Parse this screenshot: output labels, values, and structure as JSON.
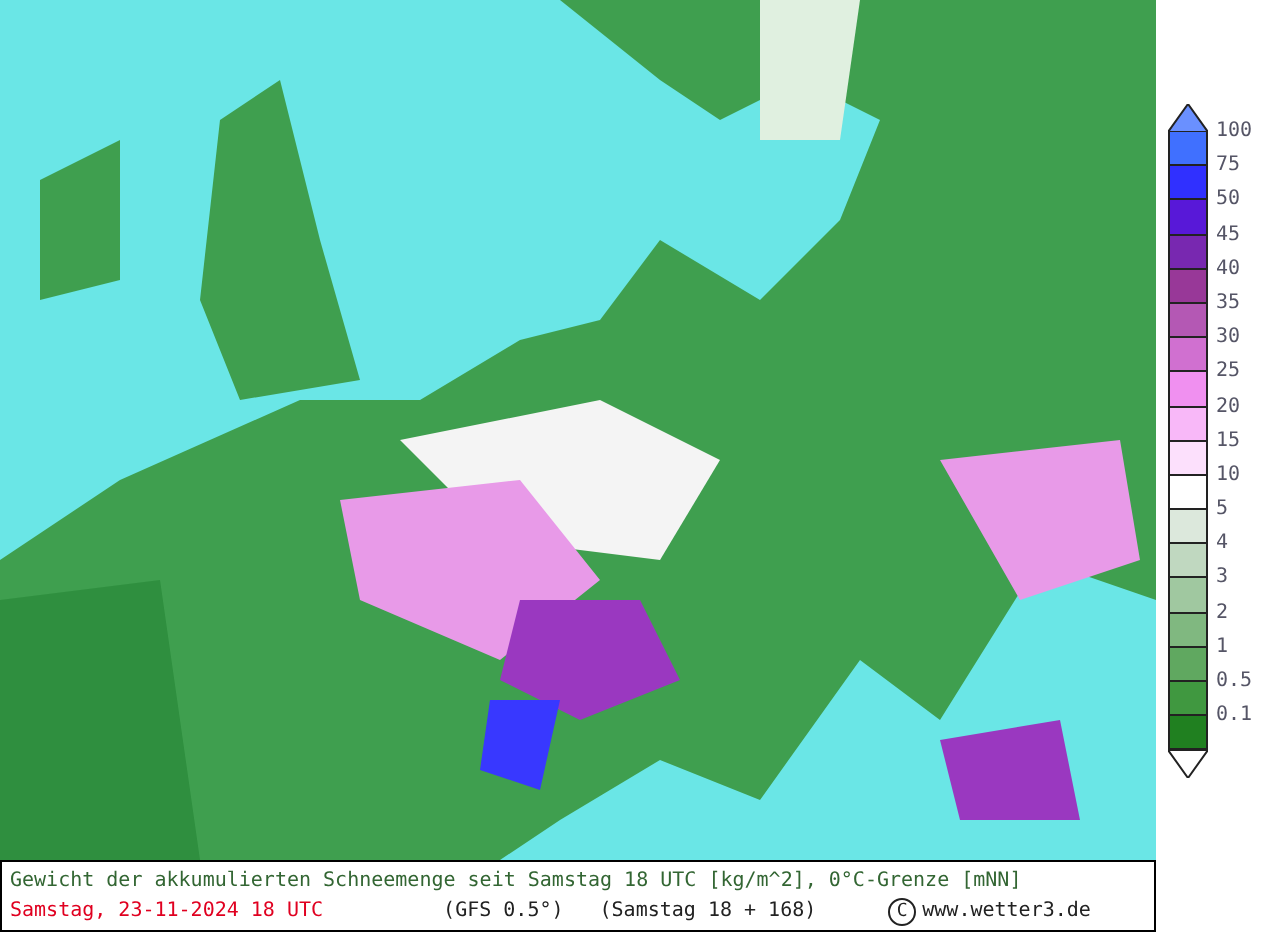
{
  "legend": {
    "items": [
      {
        "label": "100",
        "color": "#4070ff"
      },
      {
        "label": "75",
        "color": "#3030ff"
      },
      {
        "label": "50",
        "color": "#5818d8"
      },
      {
        "label": "45",
        "color": "#7828b0"
      },
      {
        "label": "40",
        "color": "#983898"
      },
      {
        "label": "35",
        "color": "#b458b4"
      },
      {
        "label": "30",
        "color": "#d070d0"
      },
      {
        "label": "25",
        "color": "#f090f0"
      },
      {
        "label": "20",
        "color": "#f8b8f8"
      },
      {
        "label": "15",
        "color": "#fce0fc"
      },
      {
        "label": "10",
        "color": "#ffffff"
      },
      {
        "label": "5",
        "color": "#dce8dc"
      },
      {
        "label": "4",
        "color": "#c0d8c0"
      },
      {
        "label": "3",
        "color": "#a0c8a0"
      },
      {
        "label": "2",
        "color": "#80b880"
      },
      {
        "label": "1",
        "color": "#60a860"
      },
      {
        "label": "0.5",
        "color": "#409840"
      },
      {
        "label": "0.1",
        "color": "#208020"
      }
    ]
  },
  "caption": {
    "title": "Gewicht der akkumulierten Schneemenge seit Samstag 18 UTC [kg/m^2], 0°C-Grenze [mNN]",
    "date": "Samstag, 23-11-2024  18 UTC",
    "model": "(GFS 0.5°)",
    "run": "(Samstag 18 + 168)",
    "copyright_symbol": "C",
    "site": "www.wetter3.de"
  }
}
